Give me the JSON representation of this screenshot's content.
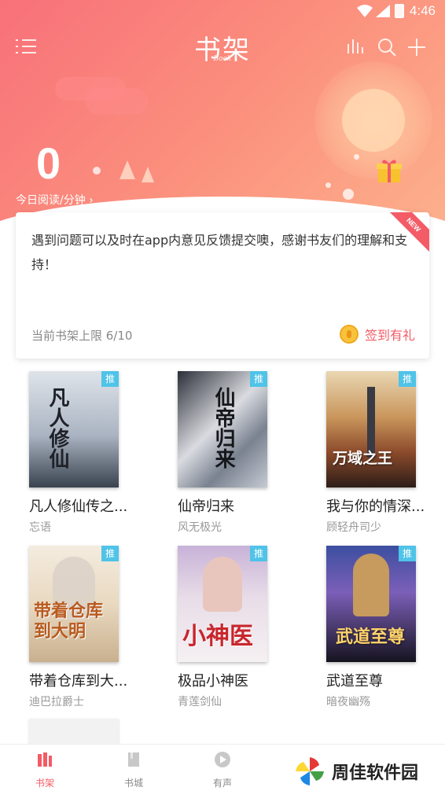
{
  "status_bar": {
    "time": "4:46"
  },
  "header": {
    "title": "书架",
    "subtitle": "Book"
  },
  "reading": {
    "count": "0",
    "label": "今日阅读/分钟 ›"
  },
  "notice": {
    "text": "遇到问题可以及时在app内意见反馈提交噢，感谢书友们的理解和支持！",
    "badge": "NEW",
    "shelf_limit": "当前书架上限 6/10",
    "checkin": "签到有礼"
  },
  "rec_badge": "推",
  "books": [
    {
      "title": "凡人修仙传之...",
      "author": "忘语",
      "cover_text": "凡人修仙"
    },
    {
      "title": "仙帝归来",
      "author": "风无极光",
      "cover_text": "仙帝归来"
    },
    {
      "title": "我与你的情深...",
      "author": "顾轻舟司少",
      "cover_text": "万域之王"
    },
    {
      "title": "带着仓库到大...",
      "author": "迪巴拉爵士",
      "cover_text": "带着仓库到大明"
    },
    {
      "title": "极品小神医",
      "author": "青莲剑仙",
      "cover_text": "小神医"
    },
    {
      "title": "武道至尊",
      "author": "暗夜幽殇",
      "cover_text": "武道至尊"
    }
  ],
  "bottom_nav": [
    {
      "label": "书架",
      "icon": "bookshelf-icon",
      "active": true
    },
    {
      "label": "书城",
      "icon": "bookstore-icon",
      "active": false
    },
    {
      "label": "有声",
      "icon": "play-icon",
      "active": false
    }
  ],
  "watermark": {
    "text": "周佳软件园"
  },
  "colors": {
    "accent": "#f35c67",
    "badge": "#4fc3e8"
  }
}
